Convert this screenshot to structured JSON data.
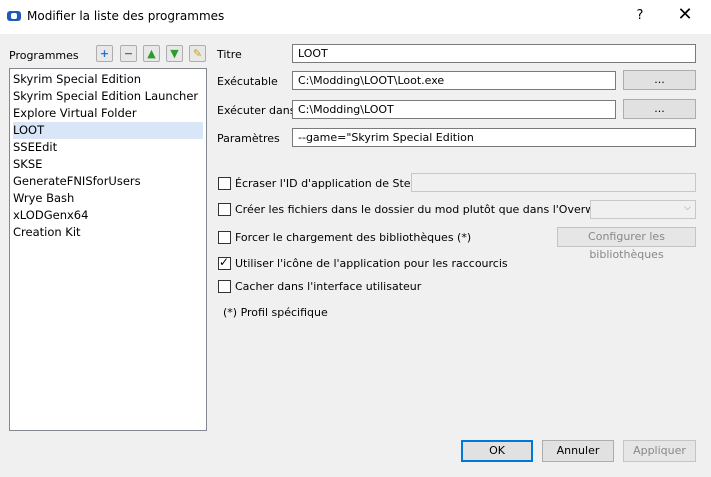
{
  "window": {
    "title": "Modifier la liste des programmes",
    "help": "?",
    "close": "✕"
  },
  "programs": {
    "label": "Programmes",
    "toolbar": {
      "add": "+",
      "remove": "−",
      "up": "▲",
      "down": "▼",
      "clean": "✎"
    },
    "items": [
      "Skyrim Special Edition",
      "Skyrim Special Edition Launcher",
      "Explore Virtual Folder",
      "LOOT",
      "SSEEdit",
      "SKSE",
      "GenerateFNISforUsers",
      "Wrye Bash",
      "xLODGenx64",
      "Creation Kit"
    ],
    "selected": "LOOT"
  },
  "form": {
    "title_label": "Titre",
    "title_value": "LOOT",
    "exe_label": "Exécutable",
    "exe_value": "C:\\Modding\\LOOT\\Loot.exe",
    "exe_browse": "...",
    "dir_label": "Exécuter dans",
    "dir_value": "C:\\Modding\\LOOT",
    "dir_browse": "...",
    "params_label": "Paramètres",
    "params_value": "--game=\"Skyrim Special Edition"
  },
  "options": {
    "steam_id": {
      "label": "Écraser l'ID d'application de Steam",
      "checked": false
    },
    "create_files": {
      "label": "Créer les fichiers dans le dossier du mod plutôt que dans l'Overwrite (*)",
      "checked": false
    },
    "force_libs": {
      "label": "Forcer le chargement des bibliothèques (*)",
      "checked": false
    },
    "configure_libs": "Configurer les bibliothèques",
    "use_icon": {
      "label": "Utiliser l'icône de l'application pour les raccourcis",
      "checked": true
    },
    "hide_ui": {
      "label": "Cacher dans l'interface utilisateur",
      "checked": false
    },
    "profile_note": "(*) Profil spécifique"
  },
  "footer": {
    "ok": "OK",
    "cancel": "Annuler",
    "apply": "Appliquer"
  }
}
